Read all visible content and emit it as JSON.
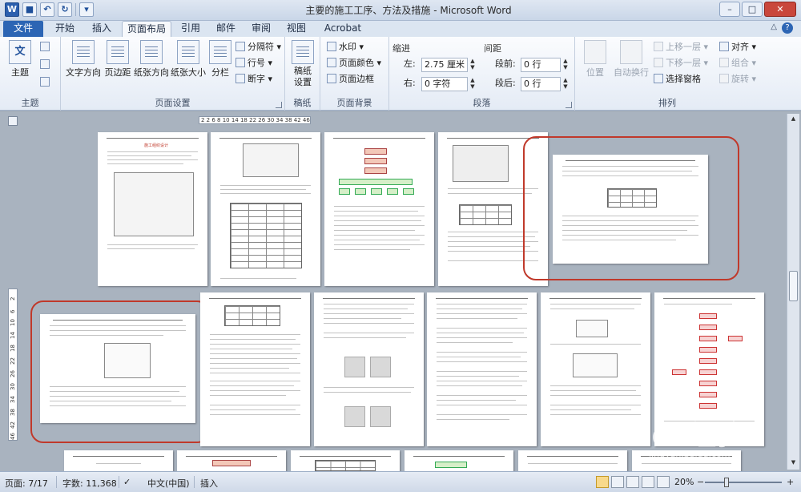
{
  "window": {
    "title": "主要的施工工序、方法及措施 - Microsoft Word"
  },
  "qat": {
    "undo": "↶",
    "redo": "↻",
    "save": "■",
    "word": "W",
    "more": "▾"
  },
  "window_buttons": {
    "minimize": "–",
    "maximize": "□",
    "close": "✕"
  },
  "tabs": [
    "文件",
    "开始",
    "插入",
    "页面布局",
    "引用",
    "邮件",
    "审阅",
    "视图",
    "Acrobat"
  ],
  "active_tab": "页面布局",
  "help": "?",
  "collapse": "△",
  "ribbon": {
    "theme": {
      "label": "主题",
      "buttons": {
        "main": "主题",
        "icon_text": "文",
        "color": "■",
        "font": "文",
        "effect": "●"
      }
    },
    "page_setup": {
      "label": "页面设置",
      "buttons": [
        "文字方向",
        "页边距",
        "纸张方向",
        "纸张大小",
        "分栏"
      ],
      "small": [
        "分隔符 ▾",
        "行号 ▾",
        "断字 ▾"
      ]
    },
    "manuscript": {
      "label": "稿纸",
      "button": "稿纸设置"
    },
    "page_background": {
      "label": "页面背景",
      "items": [
        "水印 ▾",
        "页面颜色 ▾",
        "页面边框"
      ]
    },
    "paragraph": {
      "label": "段落",
      "indent_title": "缩进",
      "spacing_title": "间距",
      "left_label": "左:",
      "left_value": "2.75 厘米",
      "right_label": "右:",
      "right_value": "0 字符",
      "before_label": "段前:",
      "before_value": "0 行",
      "after_label": "段后:",
      "after_value": "0 行"
    },
    "arrange": {
      "label": "排列",
      "buttons": [
        "位置",
        "自动换行"
      ],
      "small": [
        "上移一层 ▾",
        "下移一层 ▾",
        "选择窗格",
        "对齐 ▾",
        "组合 ▾",
        "旋转 ▾"
      ]
    }
  },
  "ruler": {
    "h_ticks": "2  2  6 8 10 14 18 22 26 30 34 38 42 46  52",
    "v_ticks": [
      "2",
      "6",
      "10",
      "14",
      "18",
      "22",
      "26",
      "30",
      "34",
      "38",
      "42",
      "46"
    ]
  },
  "doc_headings": {
    "page1_title": "施工组织设计"
  },
  "watermark": {
    "logo": "Baidu经验",
    "url": "jingyan.baidu.com"
  },
  "status": {
    "page": "页面: 7/17",
    "words": "字数: 11,368",
    "language": "中文(中国)",
    "mode": "插入",
    "zoom": "20%",
    "zoom_out": "−",
    "zoom_in": "+"
  }
}
